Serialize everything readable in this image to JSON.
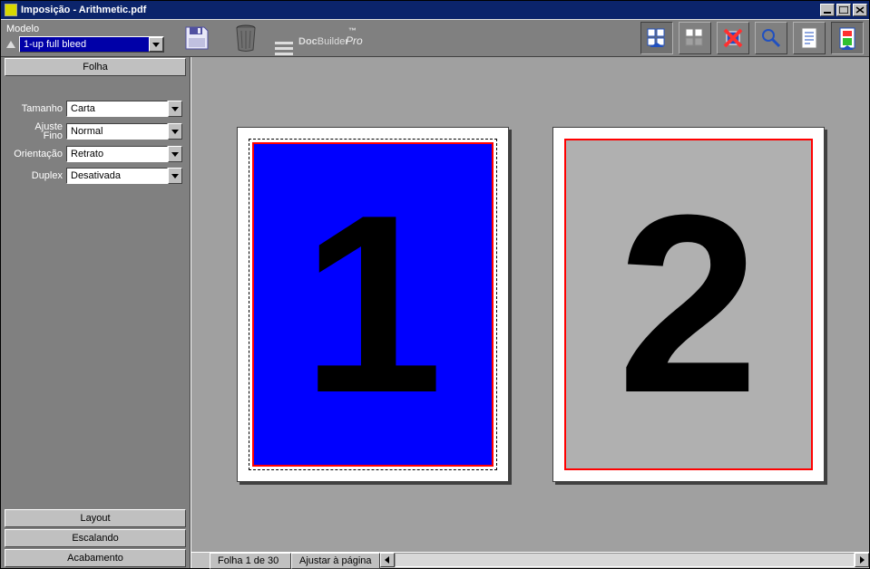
{
  "title": "Imposição - Arithmetic.pdf",
  "toolbar": {
    "model_label": "Modelo",
    "model_value": "1-up full bleed",
    "brand_doc": "Doc",
    "brand_builder": "Builder",
    "brand_tm": "™",
    "brand_sub": "Pro"
  },
  "sidebar": {
    "section_open": "Folha",
    "props": {
      "tamanho_label": "Tamanho",
      "tamanho_value": "Carta",
      "ajuste_label": "Ajuste\nFino",
      "ajuste_value": "Normal",
      "orient_label": "Orientação",
      "orient_value": "Retrato",
      "duplex_label": "Duplex",
      "duplex_value": "Desativada"
    },
    "sections": [
      "Layout",
      "Escalando",
      "Acabamento"
    ]
  },
  "canvas": {
    "page1_num": "1",
    "page2_num": "2"
  },
  "status": {
    "sheet": "Folha 1 de 30",
    "zoom": "Ajustar à página"
  }
}
